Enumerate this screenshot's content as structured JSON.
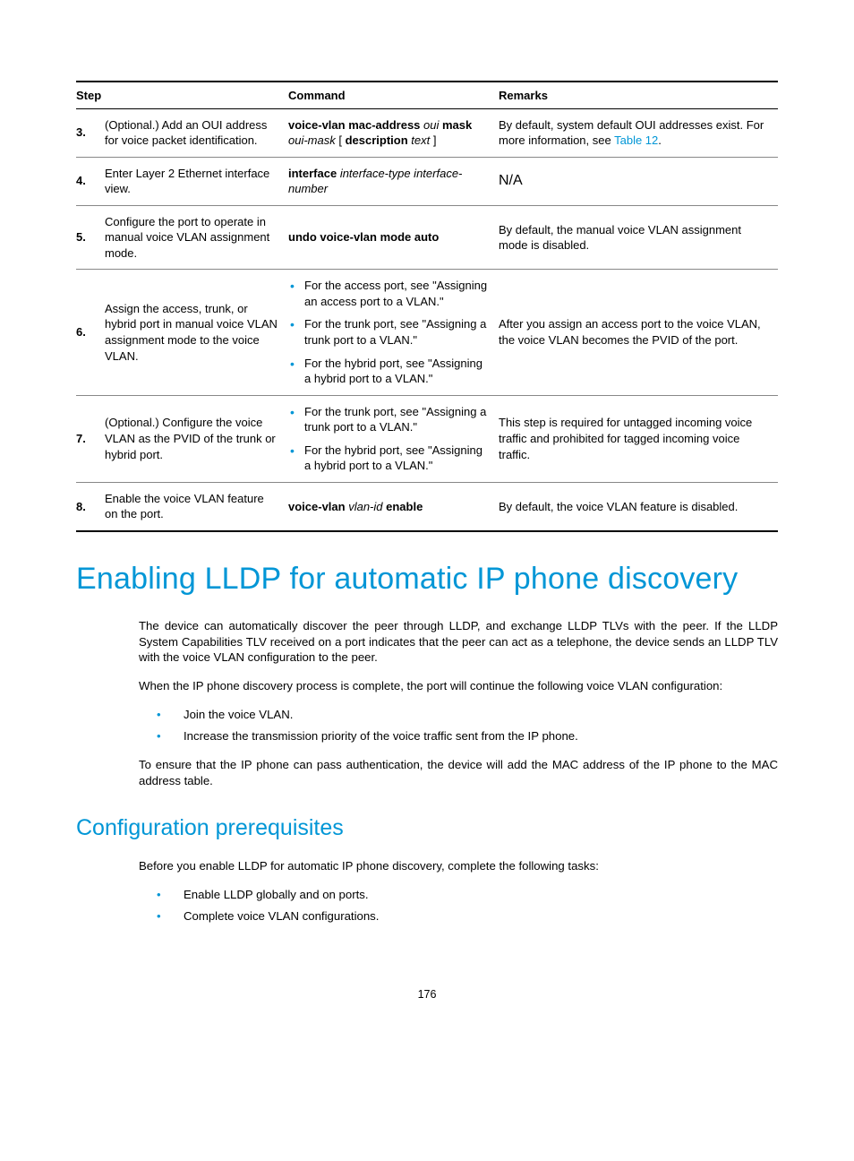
{
  "table": {
    "headers": {
      "step": "Step",
      "command": "Command",
      "remarks": "Remarks"
    },
    "rows": [
      {
        "num": "3.",
        "desc": "(Optional.) Add an OUI address for voice packet identification.",
        "cmd_parts": [
          {
            "t": "voice-vlan mac-address ",
            "c": "bold"
          },
          {
            "t": "oui ",
            "c": "ital"
          },
          {
            "t": "mask ",
            "c": "bold"
          },
          {
            "t": "oui-mask ",
            "c": "ital"
          },
          {
            "t": "[ ",
            "c": ""
          },
          {
            "t": "description ",
            "c": "bold"
          },
          {
            "t": "text ",
            "c": "ital"
          },
          {
            "t": "]",
            "c": ""
          }
        ],
        "remarks_pre": "By default, system default OUI addresses exist. For more information, see ",
        "remarks_link": "Table 12",
        "remarks_post": "."
      },
      {
        "num": "4.",
        "desc": "Enter Layer 2 Ethernet interface view.",
        "cmd_parts": [
          {
            "t": "interface ",
            "c": "bold"
          },
          {
            "t": "interface-type interface-number",
            "c": "ital"
          }
        ],
        "remarks": "N/A"
      },
      {
        "num": "5.",
        "desc": "Configure the port to operate in manual voice VLAN assignment mode.",
        "cmd_parts": [
          {
            "t": "undo voice-vlan mode auto",
            "c": "bold"
          }
        ],
        "remarks": "By default, the manual voice VLAN assignment mode is disabled."
      },
      {
        "num": "6.",
        "desc": "Assign the access, trunk, or hybrid port in manual voice VLAN assignment mode to the voice VLAN.",
        "cmd_list": [
          "For the access port, see \"Assigning an access port to a VLAN.\"",
          "For the trunk port, see \"Assigning a trunk port to a VLAN.\"",
          "For the hybrid port, see \"Assigning a hybrid port to a VLAN.\""
        ],
        "remarks": "After you assign an access port to the voice VLAN, the voice VLAN becomes the PVID of the port."
      },
      {
        "num": "7.",
        "desc": "(Optional.) Configure the voice VLAN as the PVID of the trunk or hybrid port.",
        "cmd_list": [
          "For the trunk port, see \"Assigning a trunk port to a VLAN.\"",
          "For the hybrid port, see \"Assigning a hybrid port to a VLAN.\""
        ],
        "remarks": "This step is required for untagged incoming voice traffic and prohibited for tagged incoming voice traffic."
      },
      {
        "num": "8.",
        "desc": "Enable the voice VLAN feature on the port.",
        "cmd_parts": [
          {
            "t": "voice-vlan ",
            "c": "bold"
          },
          {
            "t": "vlan-id ",
            "c": "ital"
          },
          {
            "t": "enable",
            "c": "bold"
          }
        ],
        "remarks": "By default, the voice VLAN feature is disabled."
      }
    ]
  },
  "h1": "Enabling LLDP for automatic IP phone discovery",
  "para1": "The device can automatically discover the peer through LLDP, and exchange LLDP TLVs with the peer. If the LLDP System Capabilities TLV received on a port indicates that the peer can act as a telephone, the device sends an LLDP TLV with the voice VLAN configuration to the peer.",
  "para2": "When the IP phone discovery process is complete, the port will continue the following voice VLAN configuration:",
  "list1": [
    "Join the voice VLAN.",
    "Increase the transmission priority of the voice traffic sent from the IP phone."
  ],
  "para3": "To ensure that the IP phone can pass authentication, the device will add the MAC address of the IP phone to the MAC address table.",
  "h2": "Configuration prerequisites",
  "para4": "Before you enable LLDP for automatic IP phone discovery, complete the following tasks:",
  "list2": [
    "Enable LLDP globally and on ports.",
    "Complete voice VLAN configurations."
  ],
  "page": "176"
}
